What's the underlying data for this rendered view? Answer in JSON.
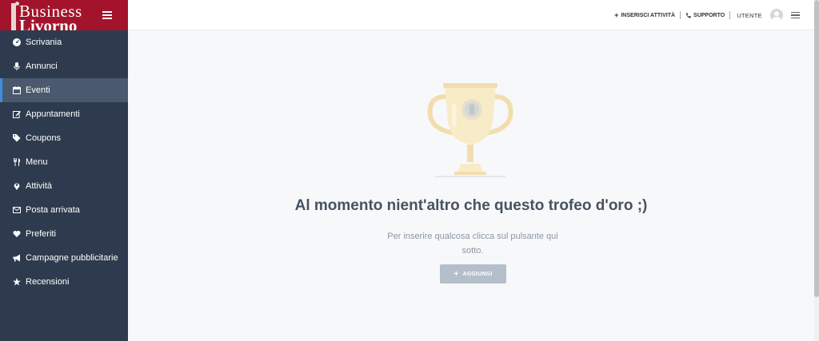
{
  "brand": {
    "line1": "Business",
    "line2": "Livorno"
  },
  "sidebar": {
    "items": [
      {
        "label": "Scrivania",
        "icon": "tachometer-icon"
      },
      {
        "label": "Annunci",
        "icon": "microphone-icon"
      },
      {
        "label": "Eventi",
        "icon": "calendar-icon",
        "active": true
      },
      {
        "label": "Appuntamenti",
        "icon": "edit-icon"
      },
      {
        "label": "Coupons",
        "icon": "tags-icon"
      },
      {
        "label": "Menu",
        "icon": "cutlery-icon"
      },
      {
        "label": "Attività",
        "icon": "map-marker-icon"
      },
      {
        "label": "Posta arrivata",
        "icon": "envelope-icon"
      },
      {
        "label": "Preferiti",
        "icon": "heart-icon"
      },
      {
        "label": "Campagne pubblicitarie",
        "icon": "bullhorn-icon"
      },
      {
        "label": "Recensioni",
        "icon": "star-icon"
      }
    ]
  },
  "topbar": {
    "add_activity": "INSERISCI ATTIVITÀ",
    "support": "SUPPORTO",
    "user": "UTENTE"
  },
  "main": {
    "headline": "Al momento nient'altro che questo trofeo d'oro ;)",
    "subtext": "Per inserire qualcosa clicca sul pulsante qui sotto.",
    "add_button": "AGGIUNGI"
  },
  "colors": {
    "sidebar_bg": "#2e3b4e",
    "brand_bg": "#a3142c",
    "active_item_bg": "#4a596d",
    "active_accent": "#3d8ee0",
    "button_bg": "#b4bfcb",
    "headline": "#46535f"
  }
}
